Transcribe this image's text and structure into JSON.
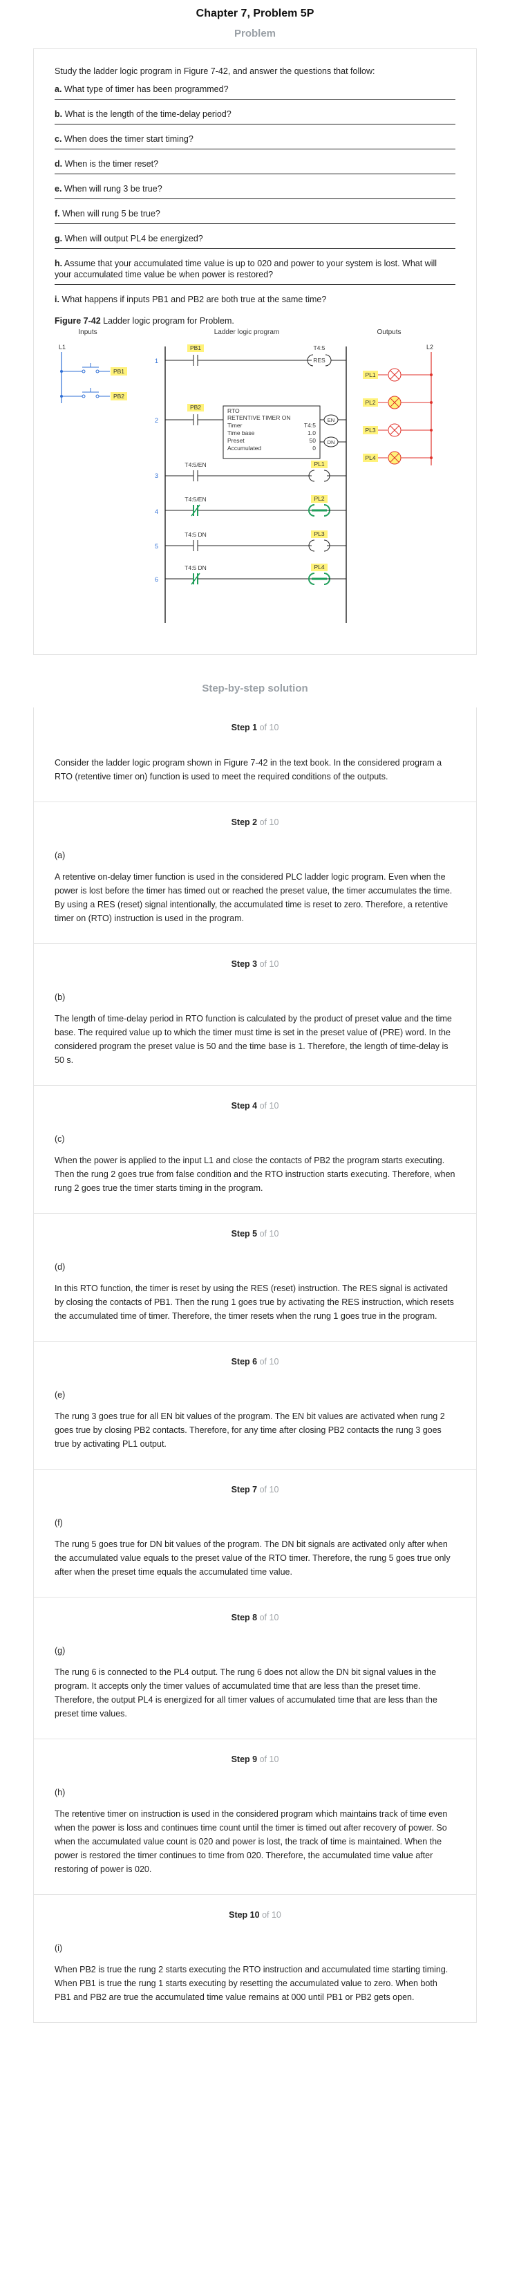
{
  "header": {
    "chapter_title": "Chapter 7, Problem 5P",
    "problem_label": "Problem",
    "solution_label": "Step-by-step solution"
  },
  "problem": {
    "intro": "Study the ladder logic program in Figure 7-42, and answer the questions that follow:",
    "questions": [
      {
        "letter": "a.",
        "text": "What type of timer has been programmed?"
      },
      {
        "letter": "b.",
        "text": "What is the length of the time-delay period?"
      },
      {
        "letter": "c.",
        "text": "When does the timer start timing?"
      },
      {
        "letter": "d.",
        "text": "When is the timer reset?"
      },
      {
        "letter": "e.",
        "text": "When will rung 3 be true?"
      },
      {
        "letter": "f.",
        "text": "When will rung 5 be true?"
      },
      {
        "letter": "g.",
        "text": "When will output PL4 be energized?"
      },
      {
        "letter": "h.",
        "text": "Assume that your accumulated time value is up to 020 and power to your system is lost. What will your accumulated time value be when power is restored?"
      },
      {
        "letter": "i.",
        "text": "What happens if inputs PB1 and PB2 are both true at the same time?"
      }
    ],
    "figure": {
      "caption_bold": "Figure 7-42",
      "caption_text": " Ladder logic program for Problem.",
      "inputs_label": "Inputs",
      "program_label": "Ladder logic program",
      "outputs_label": "Outputs",
      "l1": "L1",
      "l2": "L2",
      "pb1": "PB1",
      "pb2": "PB2",
      "rung_numbers": [
        "1",
        "2",
        "3",
        "4",
        "5",
        "6"
      ],
      "rung1_contact": "PB1",
      "rung1_coil_tag": "T4:5",
      "rung1_coil": "RES",
      "rung2_contact": "PB2",
      "rto_block": {
        "title1": "RTO",
        "title2": "RETENTIVE TIMER ON",
        "rows": [
          {
            "label": "Timer",
            "value": "T4:5"
          },
          {
            "label": "Time base",
            "value": "1.0"
          },
          {
            "label": "Preset",
            "value": "50"
          },
          {
            "label": "Accumulated",
            "value": "0"
          }
        ],
        "en": "EN",
        "dn": "DN"
      },
      "rung3_contact": "T4:5/EN",
      "rung3_coil": "PL1",
      "rung4_contact": "T4:5/EN",
      "rung4_coil": "PL2",
      "rung5_contact": "T4:5 DN",
      "rung5_coil": "PL3",
      "rung6_contact": "T4:5 DN",
      "rung6_coil": "PL4",
      "outputs": [
        "PL1",
        "PL2",
        "PL3",
        "PL4"
      ],
      "colors": {
        "highlight": "#fff27a",
        "input": "#2f6fd6",
        "output": "#e0322b",
        "green": "#1f9e5a",
        "lamp_on": "#fff27a"
      }
    }
  },
  "steps": [
    {
      "num": "Step 1",
      "of": "of 10",
      "part": "",
      "text": "Consider the ladder logic program shown in Figure 7-42 in the text book. In the considered program a RTO (retentive timer on) function is used to meet the required conditions of the outputs."
    },
    {
      "num": "Step 2",
      "of": "of 10",
      "part": "(a)",
      "text": "A retentive on-delay timer function is used in the considered PLC ladder logic program. Even when the power is lost before the timer has timed out or reached the preset value, the timer accumulates the time. By using a RES (reset) signal intentionally, the accumulated time is reset to zero. Therefore, a retentive timer on (RTO) instruction is used in the program."
    },
    {
      "num": "Step 3",
      "of": "of 10",
      "part": "(b)",
      "text": "The length of time-delay period in RTO function is calculated by the product of preset value and the time base. The required value up to which the timer must time is set in the preset value of (PRE) word. In the considered program the preset value is 50 and the time base is 1. Therefore, the length of time-delay is 50 s."
    },
    {
      "num": "Step 4",
      "of": "of 10",
      "part": "(c)",
      "text": "When the power is applied to the input L1 and close the contacts of PB2 the program starts executing. Then the rung 2 goes true from false condition and the RTO instruction starts executing. Therefore, when rung 2 goes true the timer starts timing in the program."
    },
    {
      "num": "Step 5",
      "of": "of 10",
      "part": "(d)",
      "text": "In this RTO function, the timer is reset by using the RES (reset) instruction. The RES signal is activated by closing the contacts of PB1. Then the rung 1 goes true by activating the RES instruction, which resets the accumulated time of timer. Therefore, the timer resets when the rung 1 goes true in the program."
    },
    {
      "num": "Step 6",
      "of": "of 10",
      "part": "(e)",
      "text": "The rung 3 goes true for all EN bit values of the program. The EN bit values are activated when rung 2 goes true by closing PB2 contacts. Therefore, for any time after closing PB2 contacts the rung 3 goes true by activating PL1 output."
    },
    {
      "num": "Step 7",
      "of": "of 10",
      "part": "(f)",
      "text": "The rung 5 goes true for DN bit values of the program. The DN bit signals are activated only after when the accumulated value equals to the preset value of the RTO timer. Therefore, the rung 5 goes true only after when the preset time equals the accumulated time value."
    },
    {
      "num": "Step 8",
      "of": "of 10",
      "part": "(g)",
      "text": "The rung 6 is connected to the PL4 output. The rung 6 does not allow the DN bit signal values in the program. It accepts only the timer values of accumulated time that are less than the preset time. Therefore, the output PL4 is energized for all timer values of accumulated time that are less than the preset time values."
    },
    {
      "num": "Step 9",
      "of": "of 10",
      "part": "(h)",
      "text": "The retentive timer on instruction is used in the considered program which maintains track of time even when the power is loss and continues time count until the timer is timed out after recovery of power. So when the accumulated value count is 020 and power is lost, the track of time is maintained. When the power is restored the timer continues to time from 020. Therefore, the accumulated time value after restoring of power is 020."
    },
    {
      "num": "Step 10",
      "of": "of 10",
      "part": "(i)",
      "text": "When PB2 is true the rung 2 starts executing the RTO instruction and accumulated time starting timing. When PB1 is true the rung 1 starts executing by resetting the accumulated value to zero. When both PB1 and PB2 are true the accumulated time value remains at 000 until PB1 or PB2 gets open."
    }
  ]
}
